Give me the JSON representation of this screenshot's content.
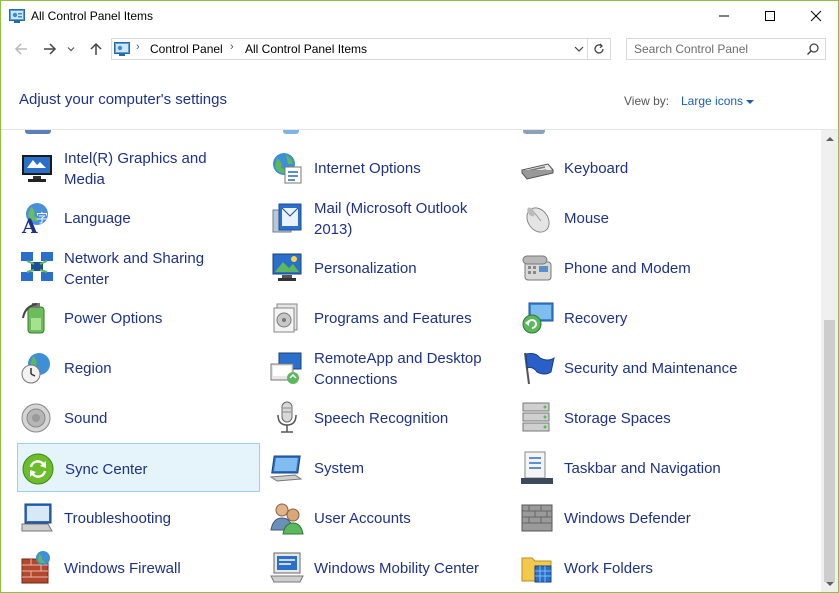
{
  "window": {
    "title": "All Control Panel Items"
  },
  "navigation": {
    "breadcrumb": [
      "Control Panel",
      "All Control Panel Items"
    ],
    "search_placeholder": "Search Control Panel"
  },
  "header": {
    "heading": "Adjust your computer's settings",
    "view_by_label": "View by:",
    "view_by_value": "Large icons"
  },
  "items": [
    {
      "lines": [
        "Intel(R) Graphics and",
        "Media"
      ],
      "icon": "intel-graphics-icon"
    },
    {
      "lines": [
        "Internet Options"
      ],
      "icon": "internet-options-icon"
    },
    {
      "lines": [
        "Keyboard"
      ],
      "icon": "keyboard-icon"
    },
    {
      "lines": [
        "Language"
      ],
      "icon": "language-icon"
    },
    {
      "lines": [
        "Mail (Microsoft Outlook",
        "2013)"
      ],
      "icon": "mail-icon"
    },
    {
      "lines": [
        "Mouse"
      ],
      "icon": "mouse-icon"
    },
    {
      "lines": [
        "Network and Sharing",
        "Center"
      ],
      "icon": "network-icon"
    },
    {
      "lines": [
        "Personalization"
      ],
      "icon": "personalization-icon"
    },
    {
      "lines": [
        "Phone and Modem"
      ],
      "icon": "phone-modem-icon"
    },
    {
      "lines": [
        "Power Options"
      ],
      "icon": "power-options-icon"
    },
    {
      "lines": [
        "Programs and Features"
      ],
      "icon": "programs-features-icon"
    },
    {
      "lines": [
        "Recovery"
      ],
      "icon": "recovery-icon"
    },
    {
      "lines": [
        "Region"
      ],
      "icon": "region-icon"
    },
    {
      "lines": [
        "RemoteApp and Desktop",
        "Connections"
      ],
      "icon": "remoteapp-icon"
    },
    {
      "lines": [
        "Security and Maintenance"
      ],
      "icon": "security-maintenance-icon"
    },
    {
      "lines": [
        "Sound"
      ],
      "icon": "sound-icon"
    },
    {
      "lines": [
        "Speech Recognition"
      ],
      "icon": "speech-recognition-icon"
    },
    {
      "lines": [
        "Storage Spaces"
      ],
      "icon": "storage-spaces-icon"
    },
    {
      "lines": [
        "Sync Center"
      ],
      "icon": "sync-center-icon"
    },
    {
      "lines": [
        "System"
      ],
      "icon": "system-icon"
    },
    {
      "lines": [
        "Taskbar and Navigation"
      ],
      "icon": "taskbar-icon"
    },
    {
      "lines": [
        "Troubleshooting"
      ],
      "icon": "troubleshooting-icon"
    },
    {
      "lines": [
        "User Accounts"
      ],
      "icon": "user-accounts-icon"
    },
    {
      "lines": [
        "Windows Defender"
      ],
      "icon": "windows-defender-icon"
    },
    {
      "lines": [
        "Windows Firewall"
      ],
      "icon": "windows-firewall-icon"
    },
    {
      "lines": [
        "Windows Mobility Center"
      ],
      "icon": "mobility-center-icon"
    },
    {
      "lines": [
        "Work Folders"
      ],
      "icon": "work-folders-icon"
    }
  ],
  "selected_item": "Sync Center",
  "colors": {
    "link": "#1e3287",
    "accent_border": "#8fbf3f",
    "selection_bg": "#e5f3fb",
    "selection_border": "#99d1ee"
  }
}
